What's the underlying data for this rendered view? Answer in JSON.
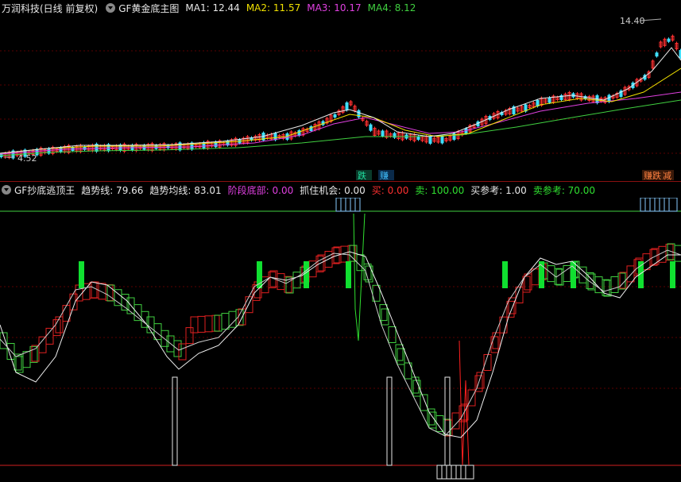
{
  "main": {
    "app_title": "万润科技(日线 前复权)",
    "indicator": "GF黄金底主图",
    "ma": [
      {
        "label": "MA1: 12.44",
        "color": "#e8e8e8"
      },
      {
        "label": "MA2: 11.57",
        "color": "#f0e000"
      },
      {
        "label": "MA3: 10.17",
        "color": "#e040e0"
      },
      {
        "label": "MA4: 8.12",
        "color": "#40d040"
      }
    ],
    "high_label": "14.40",
    "low_label": "4.52",
    "signals": [
      {
        "text": "跌",
        "color": "#20e0a0"
      },
      {
        "text": "赚",
        "color": "#40c0ff"
      },
      {
        "text": "赚跌",
        "color": "#ff8040"
      },
      {
        "text": "减",
        "color": "#ff8040"
      }
    ]
  },
  "sub": {
    "indicator": "GF抄底逃顶王",
    "fields": [
      {
        "label": "趋势线: 79.66",
        "color": "#e8e8e8"
      },
      {
        "label": "趋势均线: 83.01",
        "color": "#e8e8e8"
      },
      {
        "label": "阶段底部: 0.00",
        "color": "#e040e0"
      },
      {
        "label": "抓住机会: 0.00",
        "color": "#e8e8e8"
      },
      {
        "label": "买: 0.00",
        "color": "#ff3030"
      },
      {
        "label": "卖: 100.00",
        "color": "#30e030"
      },
      {
        "label": "买参考: 1.00",
        "color": "#e8e8e8"
      },
      {
        "label": "卖参考: 70.00",
        "color": "#30e030"
      }
    ]
  }
}
